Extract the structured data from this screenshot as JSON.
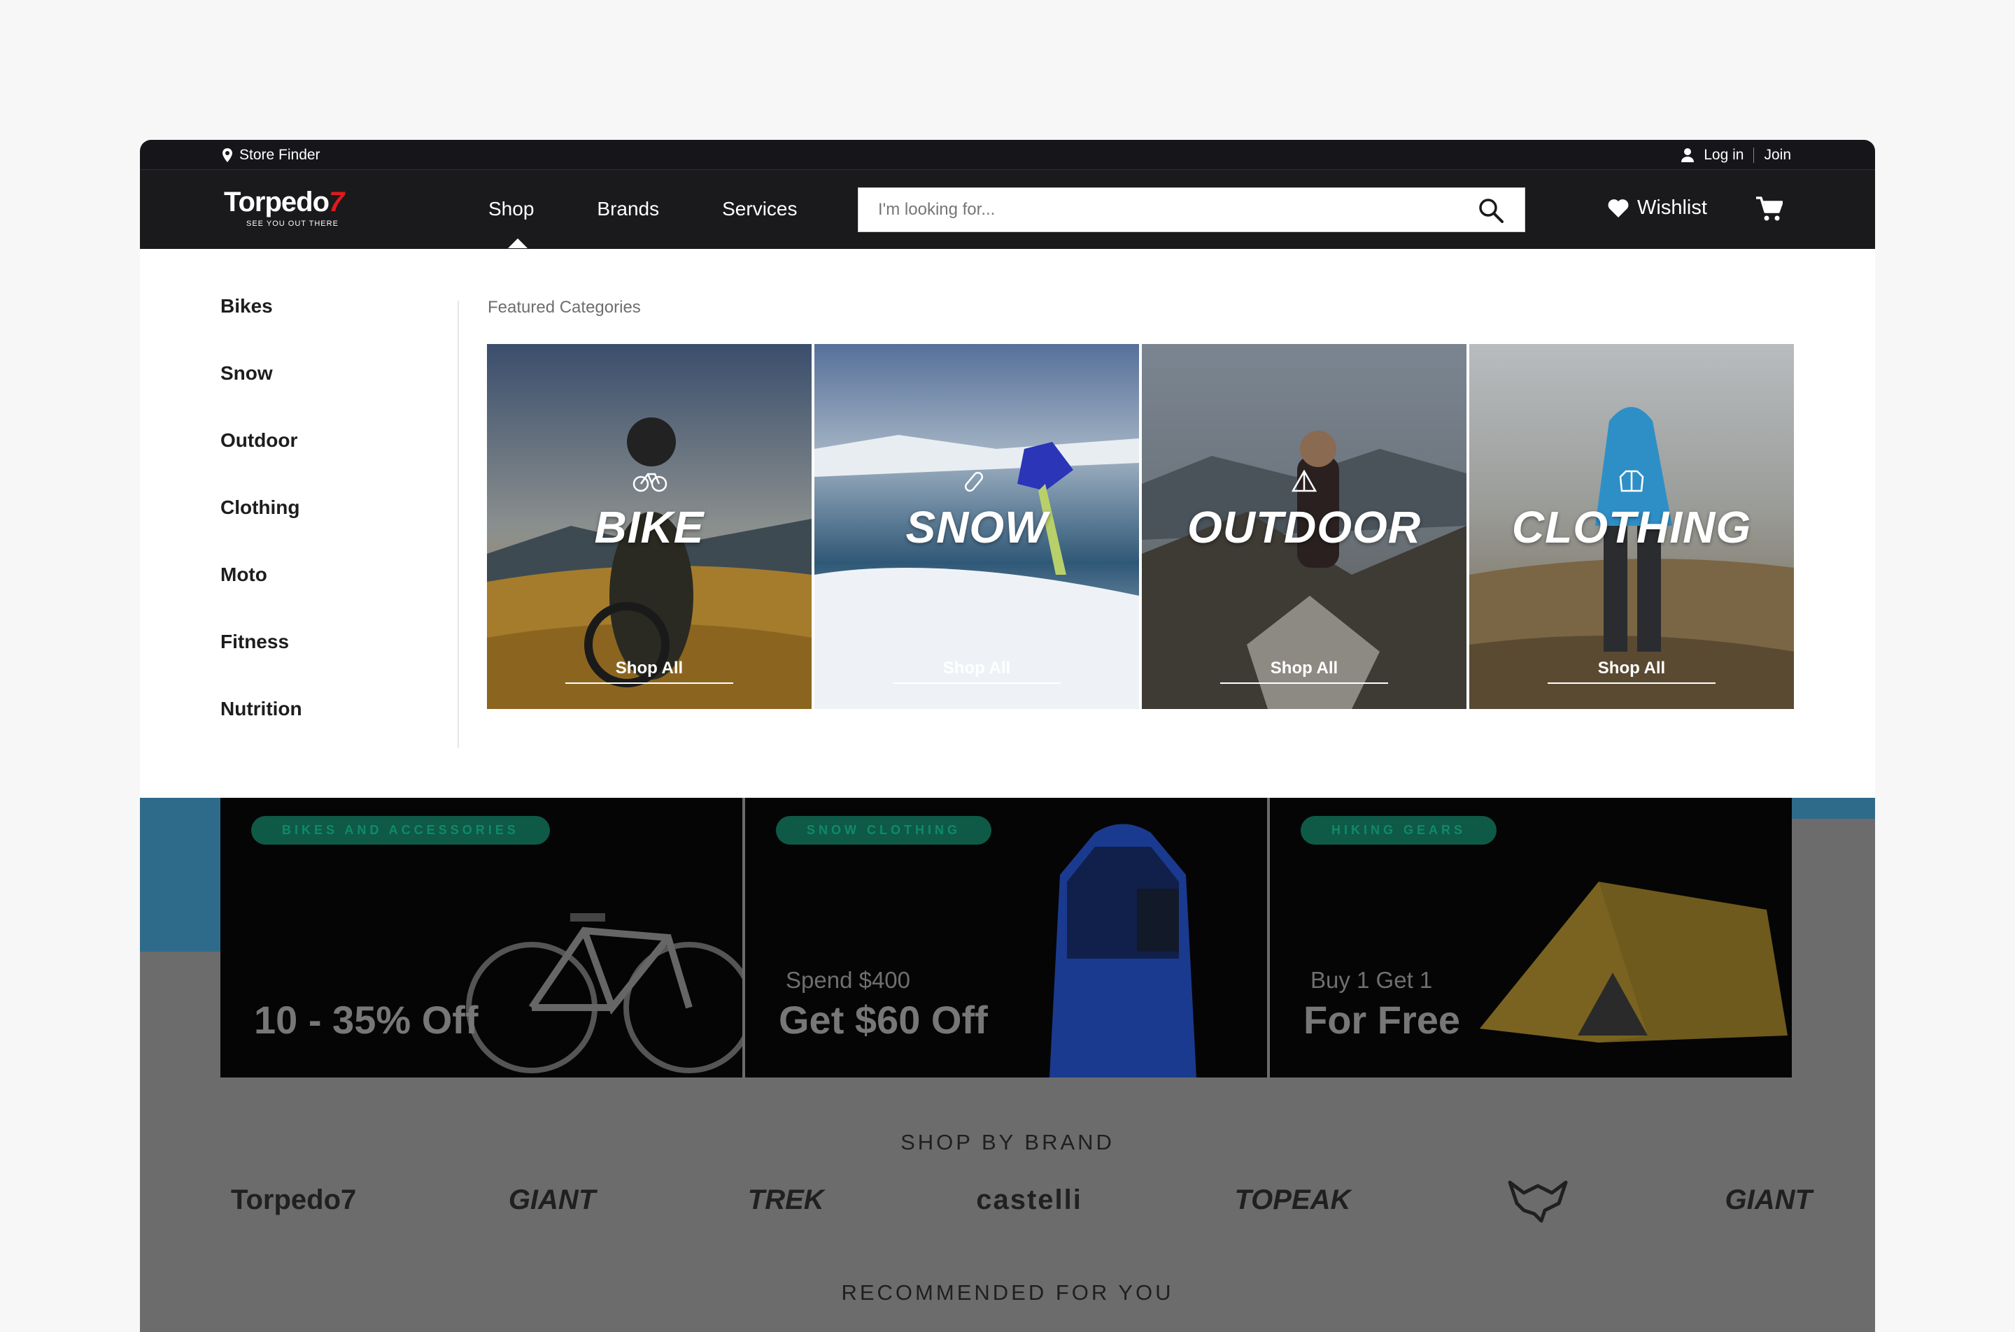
{
  "utility": {
    "store_finder": "Store Finder",
    "login": "Log in",
    "join": "Join"
  },
  "nav": {
    "logo_text": "Torpedo",
    "logo_seven": "7",
    "logo_tagline": "SEE YOU OUT THERE",
    "menu": [
      "Shop",
      "Brands",
      "Services"
    ],
    "search_placeholder": "I'm looking for...",
    "wishlist": "Wishlist"
  },
  "mega": {
    "categories": [
      "Bikes",
      "Snow",
      "Outdoor",
      "Clothing",
      "Moto",
      "Fitness",
      "Nutrition"
    ],
    "featured_title": "Featured Categories",
    "tiles": [
      {
        "name": "BIKE",
        "cta": "Shop All",
        "icon": "bike-icon"
      },
      {
        "name": "SNOW",
        "cta": "Shop All",
        "icon": "snowboard-icon"
      },
      {
        "name": "OUTDOOR",
        "cta": "Shop All",
        "icon": "tent-icon"
      },
      {
        "name": "CLOTHING",
        "cta": "Shop All",
        "icon": "jacket-icon"
      }
    ]
  },
  "promos": [
    {
      "badge": "BIKES AND ACCESSORIES",
      "small": "",
      "big": "10 - 35% Off"
    },
    {
      "badge": "SNOW CLOTHING",
      "small": "Spend $400",
      "big": "Get $60 Off"
    },
    {
      "badge": "HIKING GEARS",
      "small": "Buy 1 Get 1",
      "big": "For Free"
    }
  ],
  "shop_by_brand": {
    "title": "SHOP BY BRAND",
    "brands": [
      "Torpedo7",
      "GIANT",
      "TREK",
      "castelli",
      "TOPEAK",
      "fox-logo",
      "GIANT"
    ]
  },
  "recommended_title": "RECOMMENDED FOR YOU",
  "colors": {
    "nav_bg": "#1a1a1c",
    "badge_bg": "#0e5a46",
    "logo_accent": "#e0191e",
    "overlay": "#6c6c6c"
  }
}
